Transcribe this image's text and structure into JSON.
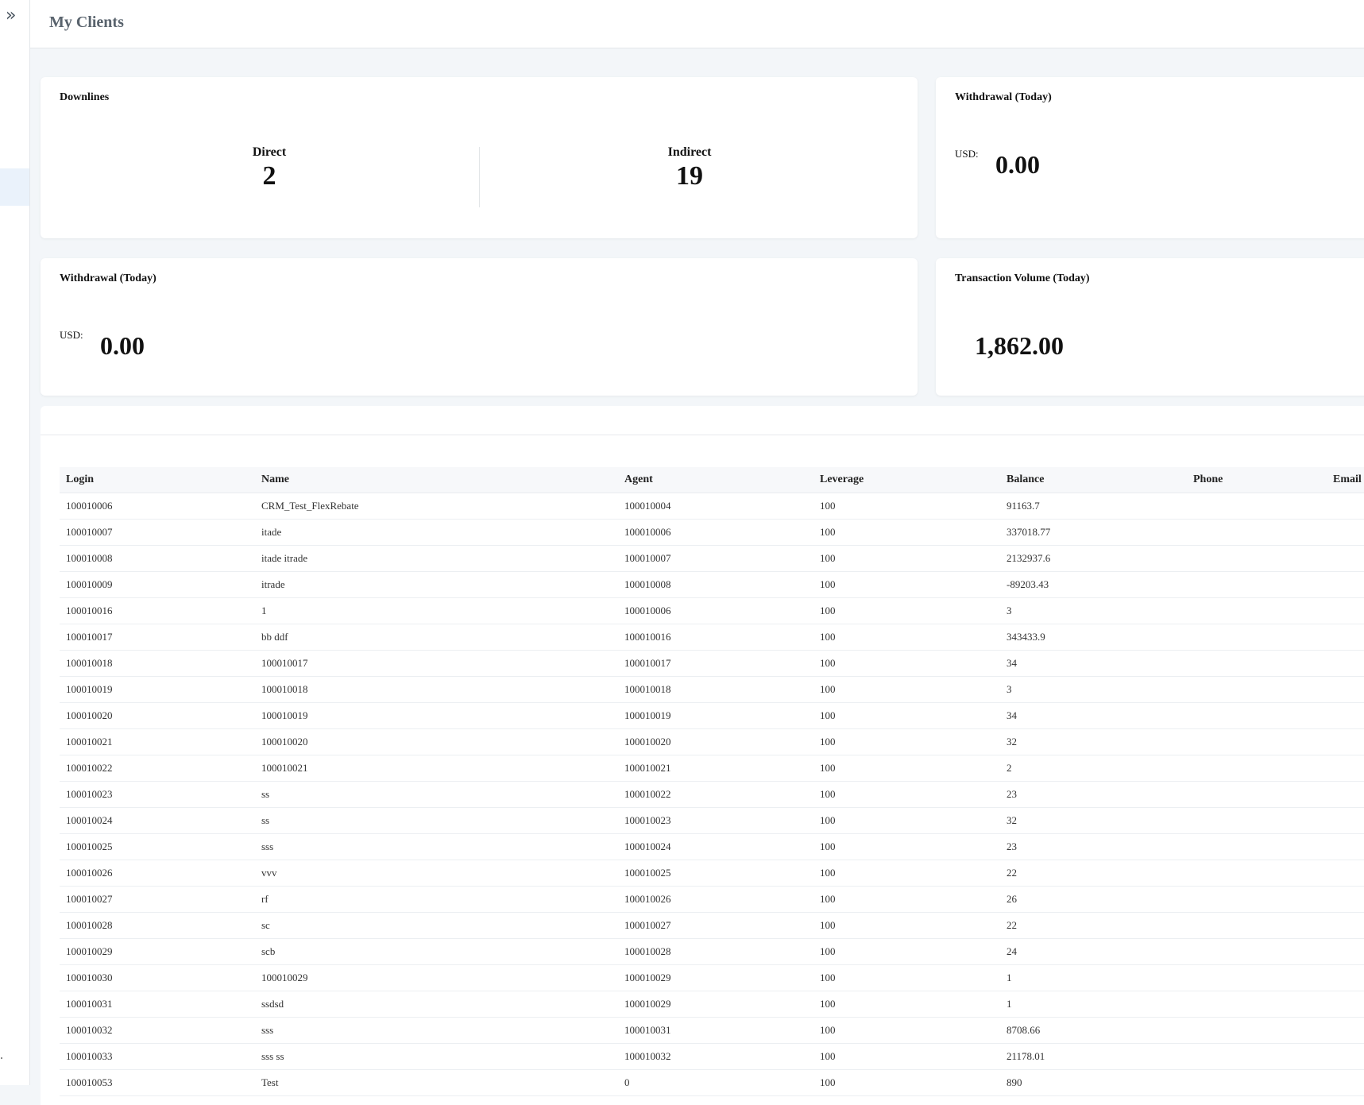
{
  "sidebar": {
    "toggle_icon": "»"
  },
  "header": {
    "title": "My Clients"
  },
  "downlines": {
    "title": "Downlines",
    "direct_label": "Direct",
    "direct_value": "2",
    "indirect_label": "Indirect",
    "indirect_value": "19"
  },
  "withdrawal_right": {
    "title": "Withdrawal (Today)",
    "currency": "USD:",
    "amount": "0.00"
  },
  "withdrawal_left": {
    "title": "Withdrawal (Today)",
    "currency": "USD:",
    "amount": "0.00"
  },
  "volume": {
    "title": "Transaction Volume (Today)",
    "amount": "1,862.00"
  },
  "table": {
    "columns": [
      "Login",
      "Name",
      "Agent",
      "Leverage",
      "Balance",
      "Phone",
      "Email"
    ],
    "rows": [
      [
        "100010006",
        "CRM_Test_FlexRebate",
        "100010004",
        "100",
        "91163.7",
        "",
        ""
      ],
      [
        "100010007",
        "itade",
        "100010006",
        "100",
        "337018.77",
        "",
        ""
      ],
      [
        "100010008",
        "itade itrade",
        "100010007",
        "100",
        "2132937.6",
        "",
        ""
      ],
      [
        "100010009",
        "itrade",
        "100010008",
        "100",
        "-89203.43",
        "",
        ""
      ],
      [
        "100010016",
        "1",
        "100010006",
        "100",
        "3",
        "",
        ""
      ],
      [
        "100010017",
        "bb ddf",
        "100010016",
        "100",
        "343433.9",
        "",
        ""
      ],
      [
        "100010018",
        "100010017",
        "100010017",
        "100",
        "34",
        "",
        ""
      ],
      [
        "100010019",
        "100010018",
        "100010018",
        "100",
        "3",
        "",
        ""
      ],
      [
        "100010020",
        "100010019",
        "100010019",
        "100",
        "34",
        "",
        ""
      ],
      [
        "100010021",
        "100010020",
        "100010020",
        "100",
        "32",
        "",
        ""
      ],
      [
        "100010022",
        "100010021",
        "100010021",
        "100",
        "2",
        "",
        ""
      ],
      [
        "100010023",
        "ss",
        "100010022",
        "100",
        "23",
        "",
        ""
      ],
      [
        "100010024",
        "ss",
        "100010023",
        "100",
        "32",
        "",
        ""
      ],
      [
        "100010025",
        "sss",
        "100010024",
        "100",
        "23",
        "",
        ""
      ],
      [
        "100010026",
        "vvv",
        "100010025",
        "100",
        "22",
        "",
        ""
      ],
      [
        "100010027",
        "rf",
        "100010026",
        "100",
        "26",
        "",
        ""
      ],
      [
        "100010028",
        "sc",
        "100010027",
        "100",
        "22",
        "",
        ""
      ],
      [
        "100010029",
        "scb",
        "100010028",
        "100",
        "24",
        "",
        ""
      ],
      [
        "100010030",
        "100010029",
        "100010029",
        "100",
        "1",
        "",
        ""
      ],
      [
        "100010031",
        "ssdsd",
        "100010029",
        "100",
        "1",
        "",
        ""
      ],
      [
        "100010032",
        "sss",
        "100010031",
        "100",
        "8708.66",
        "",
        ""
      ],
      [
        "100010033",
        "sss ss",
        "100010032",
        "100",
        "21178.01",
        "",
        ""
      ],
      [
        "100010053",
        "Test",
        "0",
        "100",
        "890",
        "",
        ""
      ]
    ]
  }
}
